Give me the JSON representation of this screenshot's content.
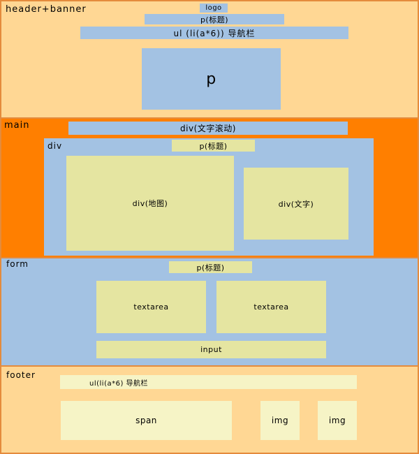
{
  "header": {
    "label": "header+banner",
    "logo": "logo",
    "title": "p(标题)",
    "nav": "ul  (li(a*6))  导航栏",
    "banner": "p"
  },
  "main": {
    "label": "main",
    "scroll": "div(文字滚动)",
    "div_label": "div",
    "title": "p(标题)",
    "map": "div(地图)",
    "text": "div(文字)"
  },
  "form": {
    "label": "form",
    "title": "p(标题)",
    "textarea1": "textarea",
    "textarea2": "textarea",
    "input": "input"
  },
  "footer": {
    "label": "footer",
    "nav": "ul(li(a*6) 导航栏",
    "span": "span",
    "img1": "img",
    "img2": "img"
  },
  "colors": {
    "peach": "#ffd794",
    "orange": "#ff7f00",
    "blue": "#a3c2e3",
    "cream": "#e5e5a1",
    "light_cream": "#f6f4c6",
    "border": "#e48b3d"
  }
}
